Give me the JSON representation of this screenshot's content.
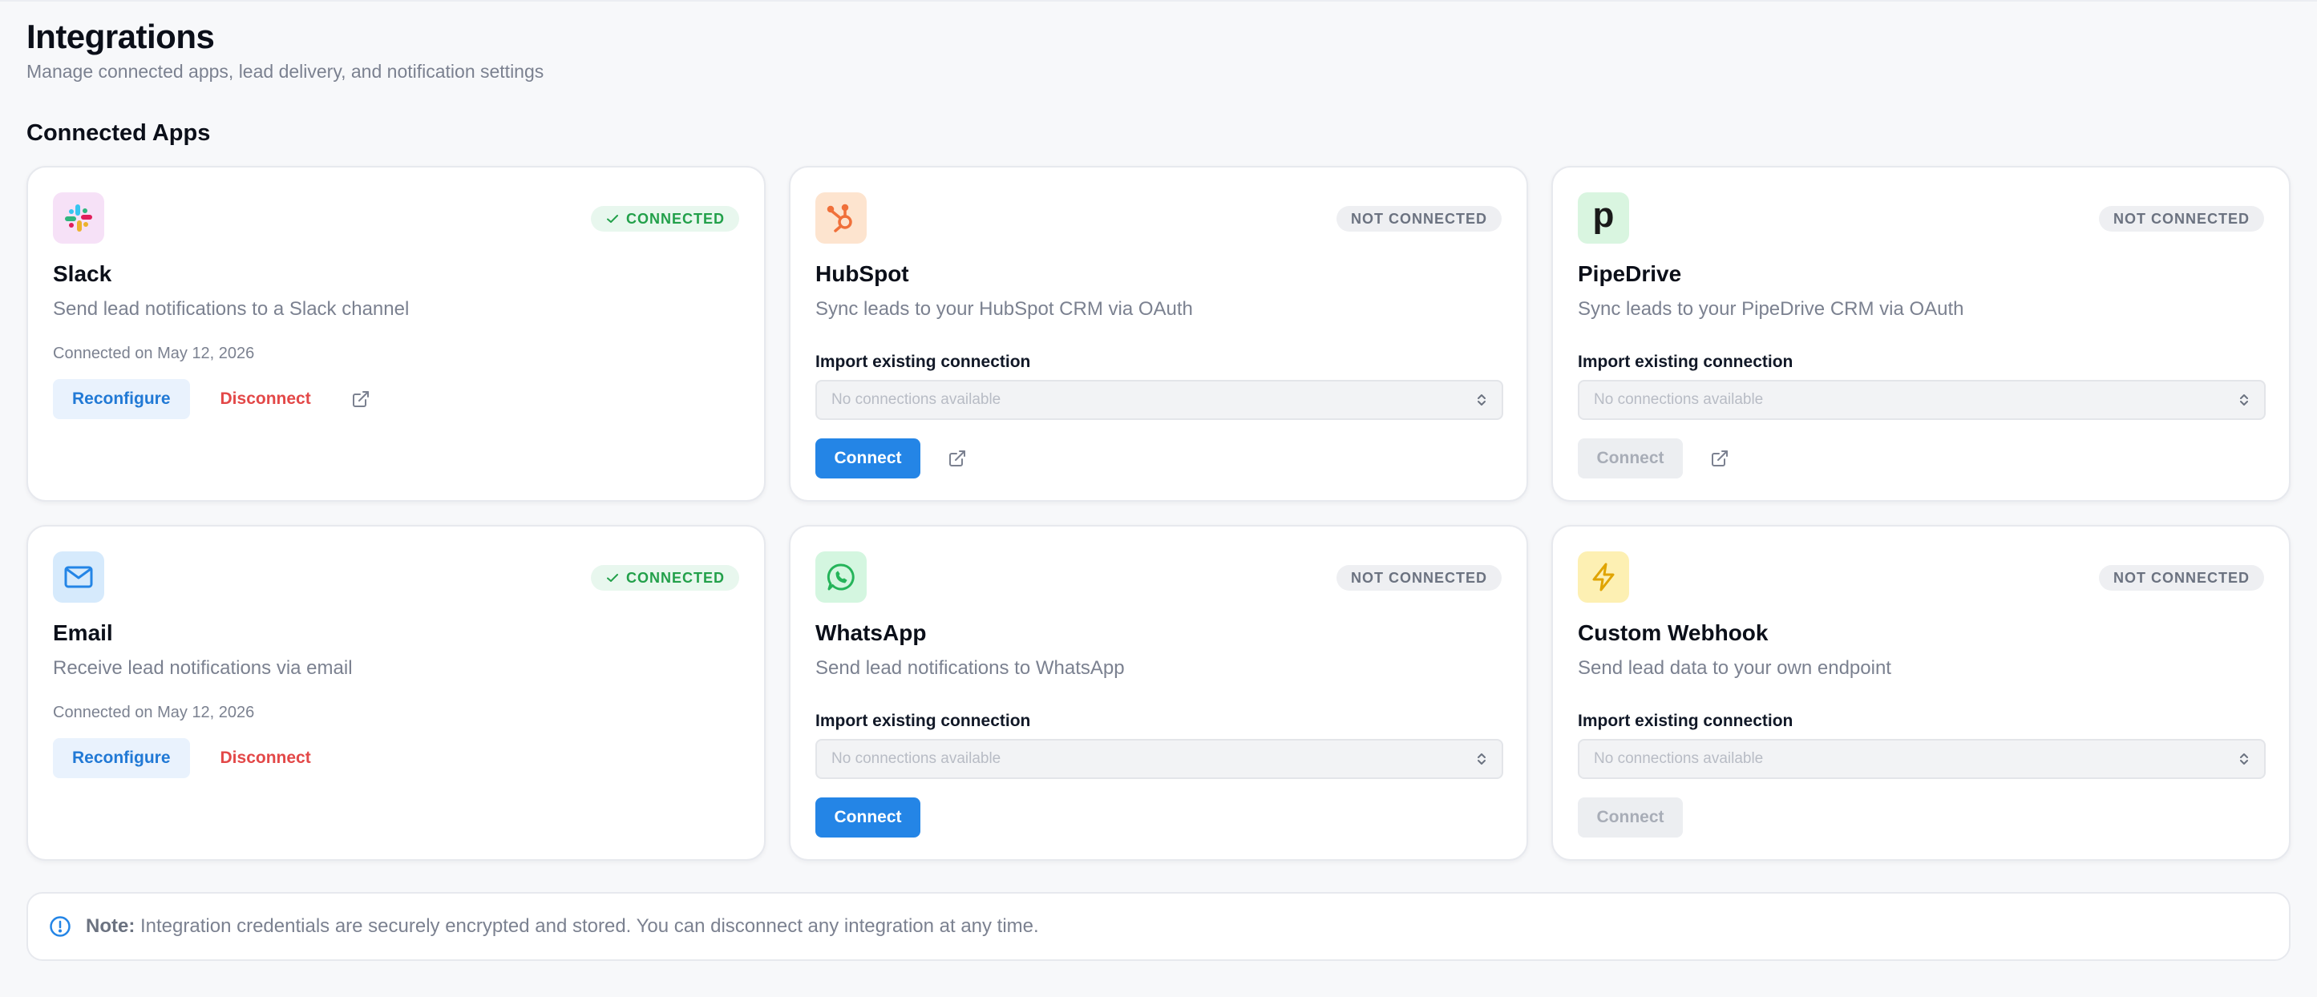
{
  "page": {
    "title": "Integrations",
    "subtitle": "Manage connected apps, lead delivery, and notification settings",
    "section_title": "Connected Apps"
  },
  "colors": {
    "primary": "#2485e6",
    "connected_green": "#22a04a",
    "disconnect_red": "#e34848",
    "muted_text": "#7b8190"
  },
  "cards": {
    "slack": {
      "icon": "slack-logo-icon",
      "title": "Slack",
      "description": "Send lead notifications to a Slack channel",
      "status": "CONNECTED",
      "connected_on": "Connected on May 12, 2026",
      "reconfigure_label": "Reconfigure",
      "disconnect_label": "Disconnect"
    },
    "hubspot": {
      "icon": "hubspot-logo-icon",
      "title": "HubSpot",
      "description": "Sync leads to your HubSpot CRM via OAuth",
      "status": "NOT CONNECTED",
      "import_label": "Import existing connection",
      "select_value": "No connections available",
      "connect_label": "Connect"
    },
    "pipedrive": {
      "icon": "pipedrive-logo-icon",
      "icon_letter": "p",
      "title": "PipeDrive",
      "description": "Sync leads to your PipeDrive CRM via OAuth",
      "status": "NOT CONNECTED",
      "import_label": "Import existing connection",
      "select_value": "No connections available",
      "connect_label": "Connect"
    },
    "email": {
      "icon": "mail-icon",
      "title": "Email",
      "description": "Receive lead notifications via email",
      "status": "CONNECTED",
      "connected_on": "Connected on May 12, 2026",
      "reconfigure_label": "Reconfigure",
      "disconnect_label": "Disconnect"
    },
    "whatsapp": {
      "icon": "whatsapp-logo-icon",
      "title": "WhatsApp",
      "description": "Send lead notifications to WhatsApp",
      "status": "NOT CONNECTED",
      "import_label": "Import existing connection",
      "select_value": "No connections available",
      "connect_label": "Connect"
    },
    "webhook": {
      "icon": "lightning-bolt-icon",
      "title": "Custom Webhook",
      "description": "Send lead data to your own endpoint",
      "status": "NOT CONNECTED",
      "import_label": "Import existing connection",
      "select_value": "No connections available",
      "connect_label": "Connect"
    }
  },
  "note": {
    "label": "Note:",
    "text": "Integration credentials are securely encrypted and stored. You can disconnect any integration at any time."
  }
}
